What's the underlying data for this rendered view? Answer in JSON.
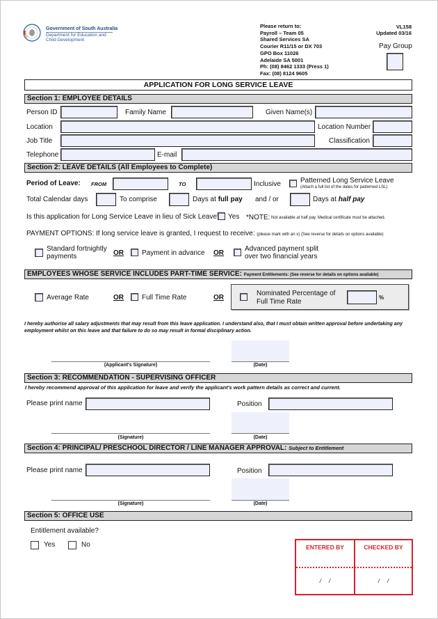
{
  "header": {
    "org_name": "Government of South Australia",
    "dept_line1": "Department for Education and",
    "dept_line2": "Child Development",
    "logo_icon": "sa-government-crest-icon",
    "return_to": [
      "Please return to:",
      "Payroll – Team 05",
      "Shared Services SA",
      "Courier R11/15 or DX 703",
      "GPO Box 11026",
      "Adelaide SA 5001",
      "Ph: (08) 8462 1333 (Press 1)",
      "Fax: (08) 8124 9605"
    ],
    "form_code": "VL158",
    "updated": "Updated 03/16",
    "pay_group_label": "Pay Group",
    "pay_group_value": ""
  },
  "title": "APPLICATION FOR LONG SERVICE LEAVE",
  "section1": {
    "heading": "Section 1: EMPLOYEE DETAILS",
    "person_id_label": "Person ID",
    "family_name_label": "Family Name",
    "given_names_label": "Given Name(s)",
    "location_label": "Location",
    "location_number_label": "Location Number",
    "job_title_label": "Job Title",
    "classification_label": "Classification",
    "telephone_label": "Telephone",
    "email_label": "E-mail",
    "values": {
      "person_id": "",
      "family_name": "",
      "given_names": "",
      "location": "",
      "location_number": "",
      "job_title": "",
      "classification": "",
      "telephone": "",
      "email": ""
    }
  },
  "section2": {
    "heading": "Section 2: LEAVE DETAILS (All Employees to Complete)",
    "period_label": "Period of Leave:",
    "from_label": "FROM",
    "to_label": "TO",
    "inclusive_label": "Inclusive",
    "patterned_label": "Patterned Long Service Leave",
    "patterned_note": "(Attach a full list of the dates for patterned LSL)",
    "total_days_label": "Total Calendar days",
    "to_comprise_label": "To comprise",
    "days_at_label": "Days at",
    "full_pay_label": "full pay",
    "and_or_label": "and / or",
    "half_pay_label": "half pay",
    "sick_leave_question": "Is this application for Long Service Leave in lieu of Sick Leave?",
    "yes_label": "Yes",
    "note_label": "*NOTE:",
    "note_text": "Not available at half pay. Medical certificate must be attached.",
    "payment_options_text": "PAYMENT OPTIONS: If long service leave is granted, I request to receive:",
    "payment_options_note": "(please mark with an x) (See reverse for details on options available)",
    "option_standard_1": "Standard fortnightly",
    "option_standard_2": "payments",
    "or_label": "OR",
    "option_advance": "Payment in advance",
    "option_split_1": "Advanced payment split",
    "option_split_2": "over two financial years",
    "parttime_heading": "EMPLOYEES WHOSE SERVICE INCLUDES PART-TIME SERVICE:",
    "parttime_note": "Payment Entitlements: (See reverse for details on options available)",
    "average_rate_label": "Average Rate",
    "full_time_rate_label": "Full Time Rate",
    "nominated_1": "Nominated Percentage of",
    "nominated_2": "Full Time Rate",
    "percent_sign": "%",
    "values": {
      "from": "",
      "to": "",
      "total_days": "",
      "full_pay_days": "",
      "half_pay_days": "",
      "nominated_percent": ""
    }
  },
  "declaration": {
    "text": "I hereby authorise all salary adjustments that may result from this leave application. I understand also, that I must obtain written approval before undertaking any employment whilst on this leave and that failure to do so may result in formal disciplinary action.",
    "signature_caption": "(Applicant's Signature)",
    "date_caption": "(Date)"
  },
  "section3": {
    "heading": "Section 3: RECOMMENDATION - SUPERVISING OFFICER",
    "statement": "I hereby recommend approval of this application for leave and verify the applicant's work pattern details as correct and current.",
    "print_name_label": "Please print name",
    "position_label": "Position",
    "signature_caption": "(Signature)",
    "date_caption": "(Date)"
  },
  "section4": {
    "heading": "Section 4: PRINCIPAL/ PRESCHOOL DIRECTOR / LINE MANAGER APPROVAL:",
    "heading_note": "Subject to Entitlement",
    "print_name_label": "Please print name",
    "position_label": "Position",
    "signature_caption": "(Signature)",
    "date_caption": "(Date)"
  },
  "section5": {
    "heading": "Section 5: OFFICE USE",
    "entitlement_question": "Entitlement available?",
    "yes_label": "Yes",
    "no_label": "No",
    "entered_by_label": "ENTERED BY",
    "checked_by_label": "CHECKED BY",
    "date_slashes": "/     /"
  },
  "colors": {
    "field_fill": "#eef0fc",
    "section_fill": "#d6d6d6",
    "stamp_red": "#d6202c",
    "brand_blue": "#1f4e8c"
  }
}
